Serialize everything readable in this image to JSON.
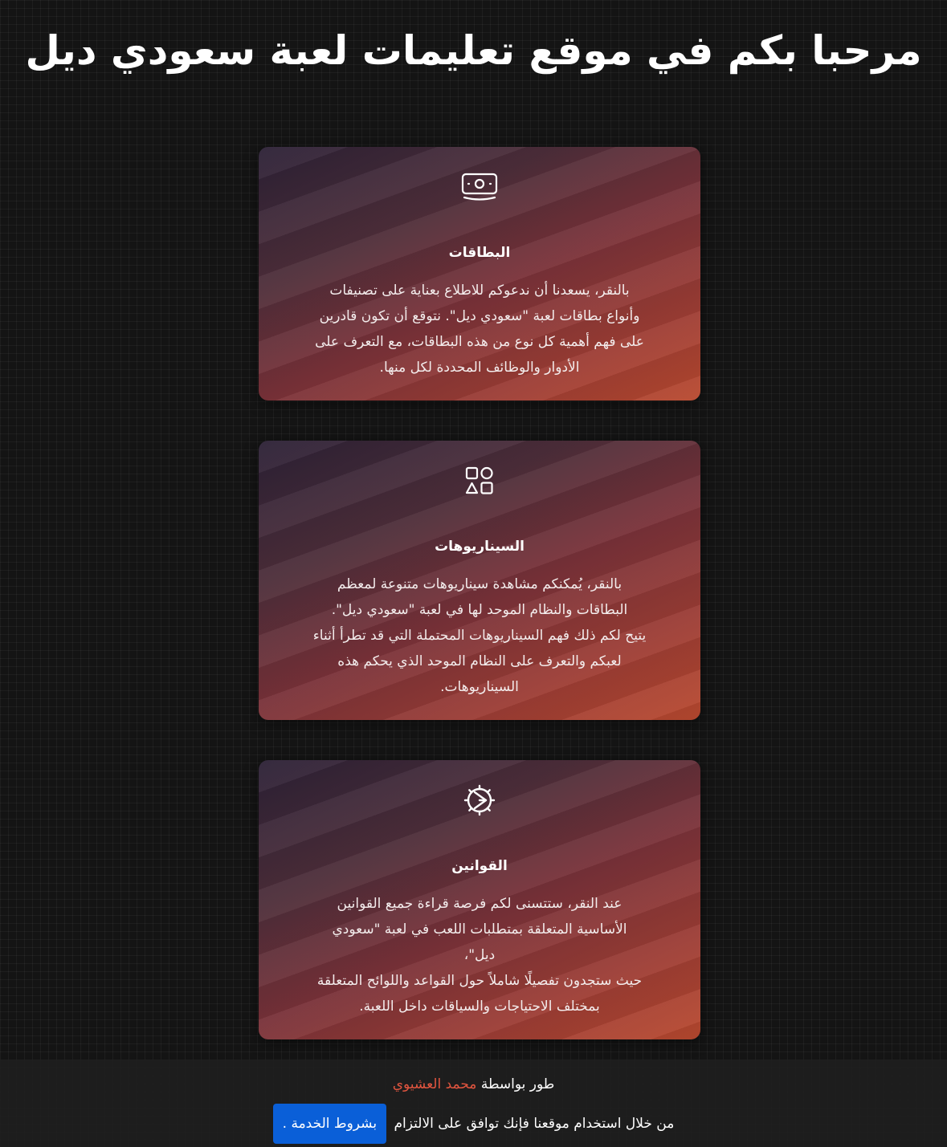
{
  "header": {
    "title": "مرحبا بكم في موقع تعليمات لعبة سعودي ديل"
  },
  "cards": [
    {
      "icon": "money-icon",
      "title": "البطاقات",
      "text": "بالنقر، يسعدنا أن ندعوكم للاطلاع بعناية على تصنيفات\nوأنواع بطاقات لعبة \"سعودي ديل\". نتوقع أن تكون قادرين\nعلى فهم أهمية كل نوع من هذه البطاقات، مع التعرف على\nالأدوار والوظائف المحددة لكل منها."
    },
    {
      "icon": "shapes-icon",
      "title": "السيناريوهات",
      "text": "بالنقر، يُمكنكم مشاهدة سيناريوهات متنوعة لمعظم\nالبطاقات والنظام الموحد لها في لعبة \"سعودي ديل\".\nيتيح لكم ذلك فهم السيناريوهات المحتملة التي قد تطرأ أثناء\nلعبكم والتعرف على النظام الموحد الذي يحكم هذه\nالسيناريوهات."
    },
    {
      "icon": "gear-icon",
      "title": "القوانين",
      "text": "عند النقر، ستتسنى لكم فرصة قراءة جميع القوانين\nالأساسية المتعلقة بمتطلبات اللعب في لعبة \"سعودي\nديل\"،\nحيث ستجدون تفصيلًا شاملاً حول القواعد واللوائح المتعلقة\nبمختلف الاحتياجات والسياقات داخل اللعبة."
    }
  ],
  "footer": {
    "developed_by": "طور بواسطة",
    "author": "محمد العشيوي",
    "terms_text": "من خلال استخدام موقعنا فإنك توافق على الالتزام",
    "terms_button": "بشروط الخدمة ."
  },
  "colors": {
    "background": "#141414",
    "author_link": "#e2553f",
    "terms_button": "#0a5fd8"
  }
}
